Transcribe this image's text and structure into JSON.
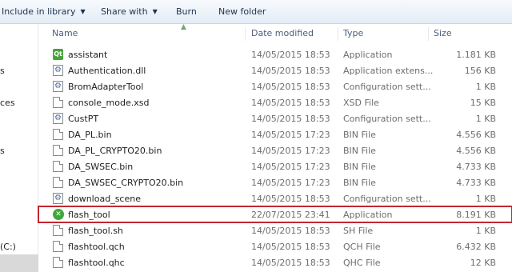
{
  "toolbar": {
    "include_label": "Include in library",
    "share_label": "Share with",
    "burn_label": "Burn",
    "new_folder_label": "New folder"
  },
  "nav": {
    "fragments": [
      "s",
      "ces",
      "s",
      "(C:)"
    ]
  },
  "columns": {
    "name": "Name",
    "date": "Date modified",
    "type": "Type",
    "size": "Size"
  },
  "files": [
    {
      "name": "assistant",
      "date": "14/05/2015 18:53",
      "type": "Application",
      "size": "1.181 KB",
      "icon": "qt-app-icon"
    },
    {
      "name": "Authentication.dll",
      "date": "14/05/2015 18:53",
      "type": "Application extens...",
      "size": "156 KB",
      "icon": "dll-icon"
    },
    {
      "name": "BromAdapterTool",
      "date": "14/05/2015 18:53",
      "type": "Configuration sett...",
      "size": "1 KB",
      "icon": "config-icon"
    },
    {
      "name": "console_mode.xsd",
      "date": "14/05/2015 18:53",
      "type": "XSD File",
      "size": "15 KB",
      "icon": "file-icon"
    },
    {
      "name": "CustPT",
      "date": "14/05/2015 18:53",
      "type": "Configuration sett...",
      "size": "1 KB",
      "icon": "config-icon"
    },
    {
      "name": "DA_PL.bin",
      "date": "14/05/2015 17:23",
      "type": "BIN File",
      "size": "4.556 KB",
      "icon": "file-icon"
    },
    {
      "name": "DA_PL_CRYPTO20.bin",
      "date": "14/05/2015 17:23",
      "type": "BIN File",
      "size": "4.556 KB",
      "icon": "file-icon"
    },
    {
      "name": "DA_SWSEC.bin",
      "date": "14/05/2015 17:23",
      "type": "BIN File",
      "size": "4.733 KB",
      "icon": "file-icon"
    },
    {
      "name": "DA_SWSEC_CRYPTO20.bin",
      "date": "14/05/2015 17:23",
      "type": "BIN File",
      "size": "4.733 KB",
      "icon": "file-icon"
    },
    {
      "name": "download_scene",
      "date": "14/05/2015 18:53",
      "type": "Configuration sett...",
      "size": "1 KB",
      "icon": "config-icon"
    },
    {
      "name": "flash_tool",
      "date": "22/07/2015 23:41",
      "type": "Application",
      "size": "8.191 KB",
      "icon": "flash-tool-icon",
      "highlighted": true
    },
    {
      "name": "flash_tool.sh",
      "date": "14/05/2015 18:53",
      "type": "SH File",
      "size": "1 KB",
      "icon": "file-icon"
    },
    {
      "name": "flashtool.qch",
      "date": "14/05/2015 18:53",
      "type": "QCH File",
      "size": "6.432 KB",
      "icon": "file-icon"
    },
    {
      "name": "flashtool.qhc",
      "date": "14/05/2015 18:53",
      "type": "QHC File",
      "size": "12 KB",
      "icon": "file-icon"
    }
  ],
  "colors": {
    "highlight_border": "#c4262e",
    "header_text": "#4c607a",
    "toolbar_text": "#1e3350"
  }
}
